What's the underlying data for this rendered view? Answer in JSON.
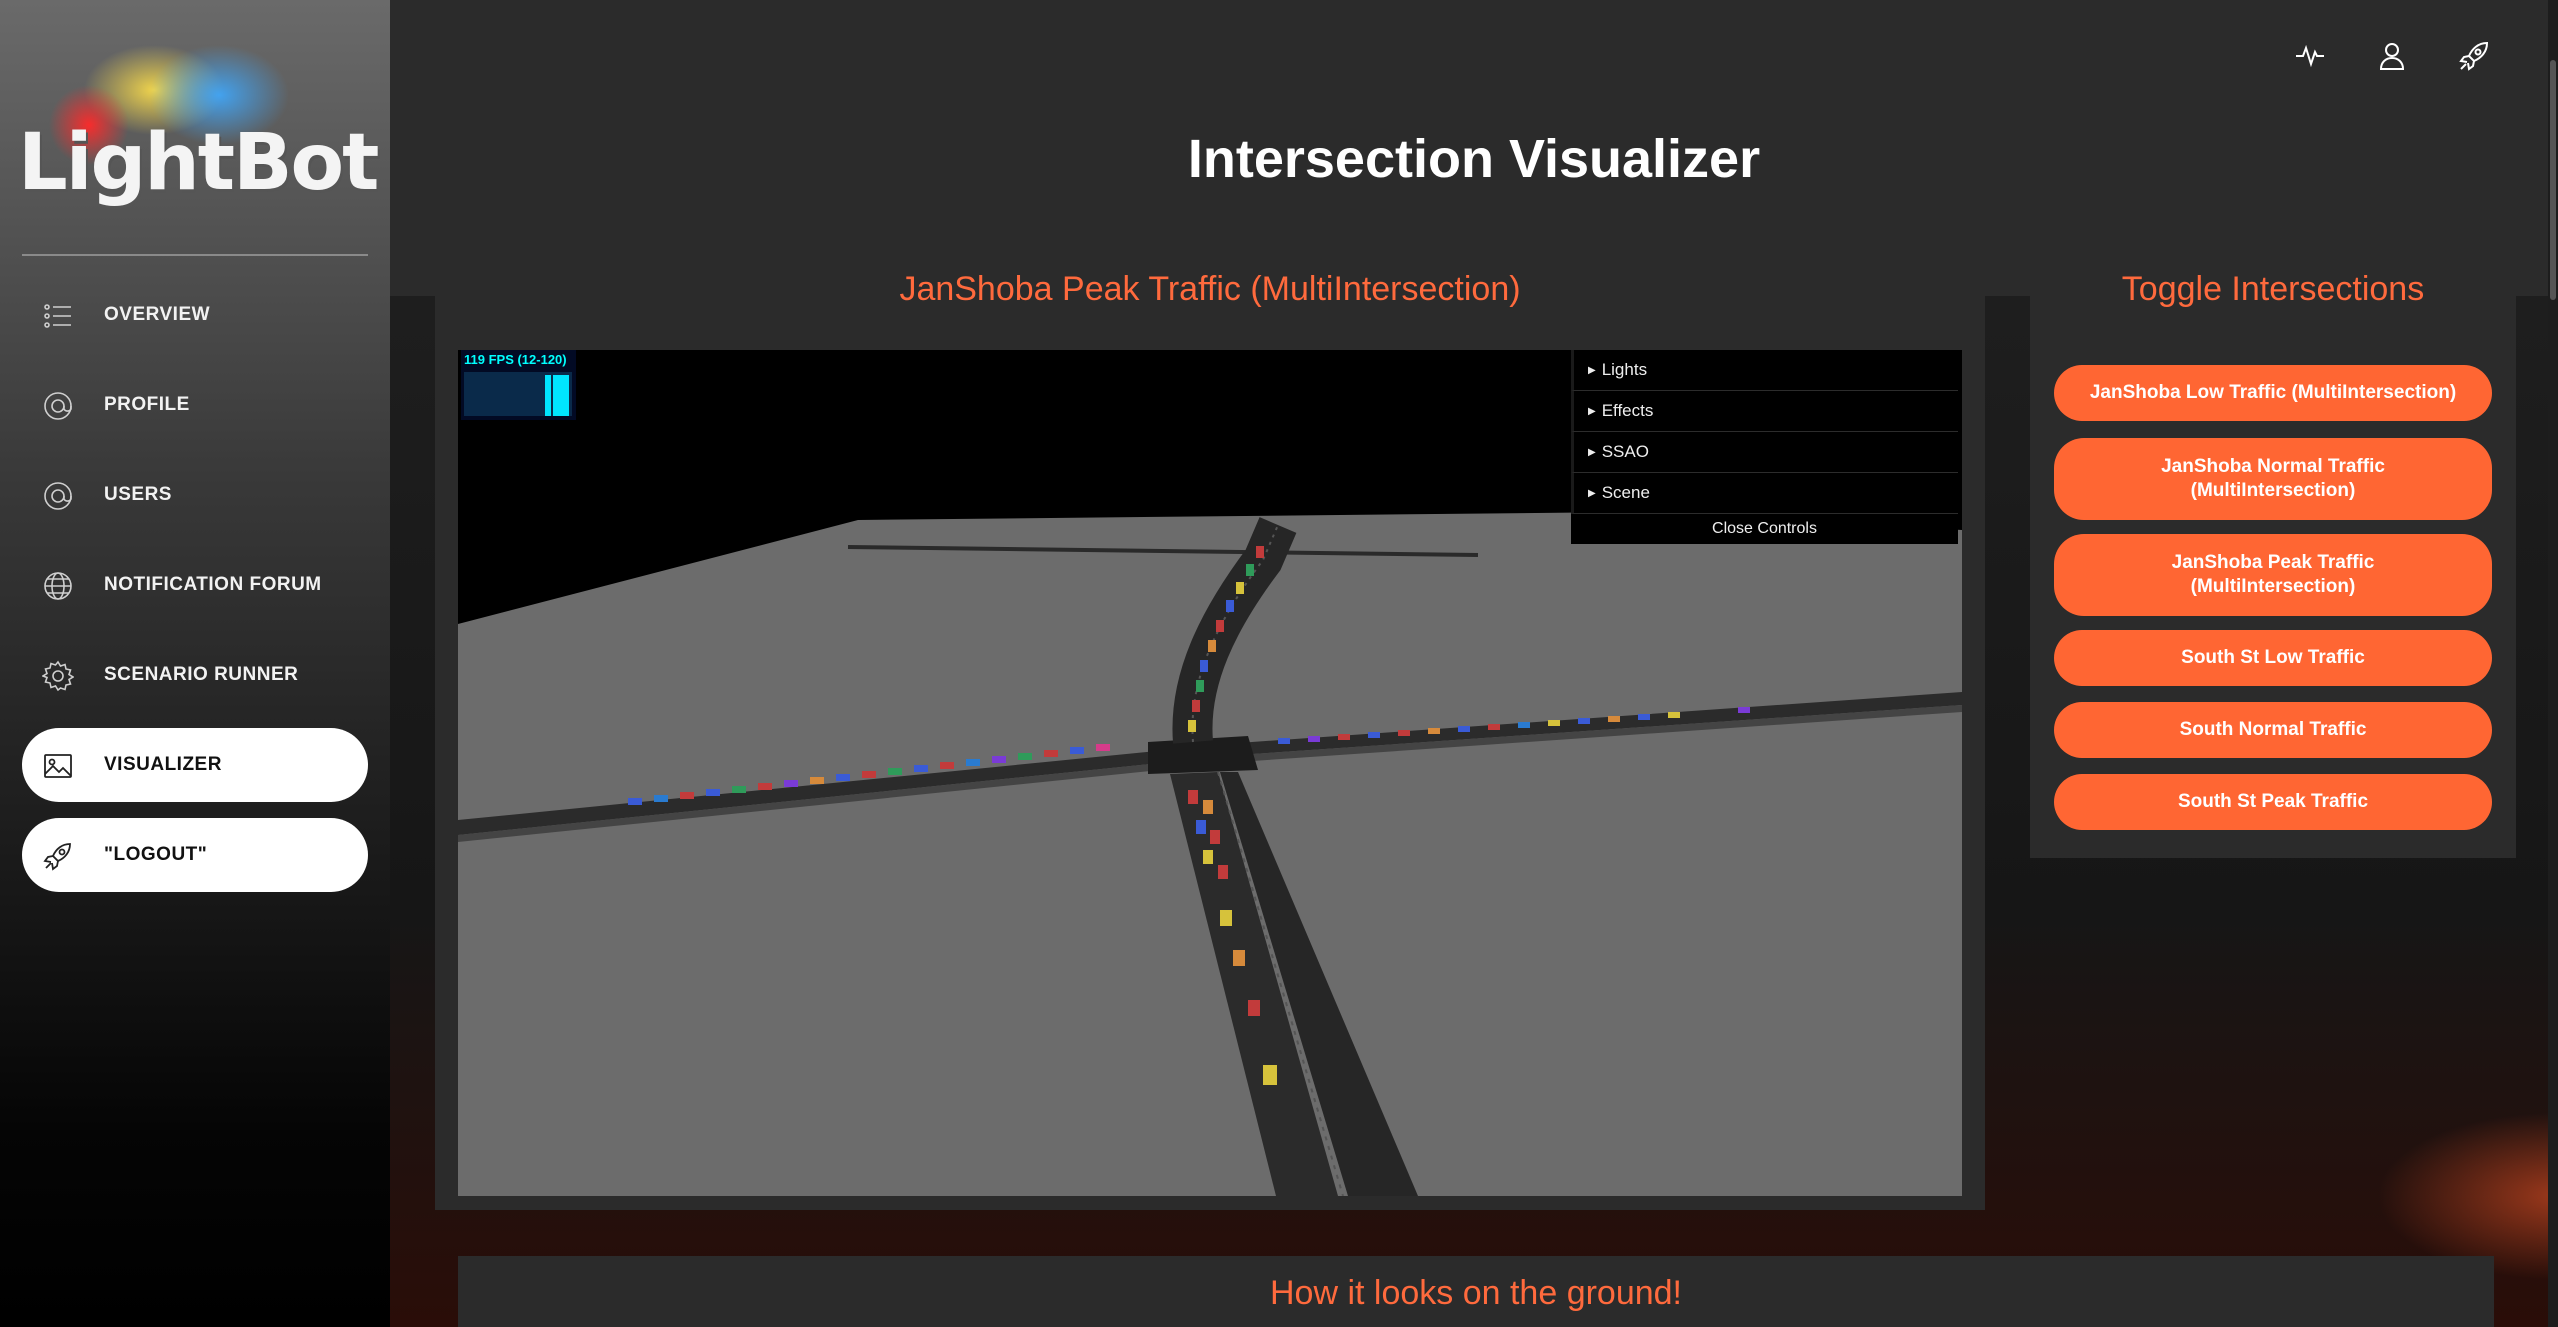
{
  "app": {
    "logo_text": "LightBot",
    "page_title": "Intersection Visualizer"
  },
  "sidebar": {
    "items": [
      {
        "label": "OVERVIEW",
        "icon": "list-icon",
        "active": false
      },
      {
        "label": "PROFILE",
        "icon": "at-sign-icon",
        "active": false
      },
      {
        "label": "USERS",
        "icon": "at-sign-icon",
        "active": false
      },
      {
        "label": "NOTIFICATION FORUM",
        "icon": "globe-icon",
        "active": false
      },
      {
        "label": "SCENARIO RUNNER",
        "icon": "gear-icon",
        "active": false
      },
      {
        "label": "VISUALIZER",
        "icon": "image-icon",
        "active": true
      },
      {
        "label": "\"LOGOUT\"",
        "icon": "rocket-icon",
        "active": true
      }
    ]
  },
  "topbar": {
    "icons": [
      "activity-icon",
      "user-icon",
      "rocket-icon"
    ]
  },
  "visualizer": {
    "title": "JanShoba Peak Traffic (MultiIntersection)",
    "fps_label": "119 FPS (12-120)",
    "controls": [
      "Lights",
      "Effects",
      "SSAO",
      "Scene"
    ],
    "close_controls": "Close Controls"
  },
  "toggle": {
    "title": "Toggle Intersections",
    "buttons": [
      "JanShoba Low Traffic (MultiIntersection)",
      "JanShoba Normal Traffic (MultiIntersection)",
      "JanShoba Peak Traffic (MultiIntersection)",
      "South St Low Traffic",
      "South Normal Traffic",
      "South St Peak Traffic"
    ]
  },
  "ground": {
    "title": "How it looks on the ground!"
  },
  "colors": {
    "accent": "#ff6633",
    "accent_text": "#ff6a3d",
    "panel": "#2b2b2b",
    "ground_plane": "#6e6e6e"
  }
}
